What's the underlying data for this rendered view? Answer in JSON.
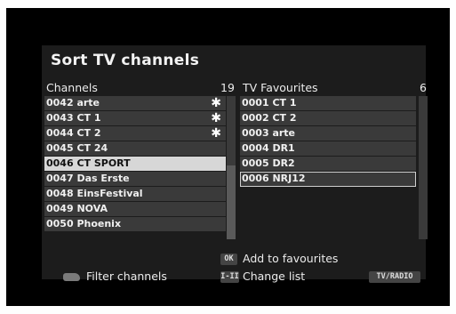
{
  "title": "Sort TV channels",
  "channels": {
    "header": "Channels",
    "count": "19",
    "items": [
      {
        "label": "0042 arte",
        "star": "✱"
      },
      {
        "label": "0043 CT 1",
        "star": "✱"
      },
      {
        "label": "0044 CT 2",
        "star": "✱"
      },
      {
        "label": "0045 CT 24",
        "star": ""
      },
      {
        "label": "0046 CT SPORT",
        "star": ""
      },
      {
        "label": "0047 Das Erste",
        "star": ""
      },
      {
        "label": "0048 EinsFestival",
        "star": ""
      },
      {
        "label": "0049 NOVA",
        "star": ""
      },
      {
        "label": "0050 Phoenix",
        "star": ""
      }
    ]
  },
  "favourites": {
    "header": "TV Favourites",
    "count": "6",
    "items": [
      {
        "label": "0001 CT 1"
      },
      {
        "label": "0002 CT 2"
      },
      {
        "label": "0003 arte"
      },
      {
        "label": "0004 DR1"
      },
      {
        "label": "0005 DR2"
      },
      {
        "label": "0006 NRJ12"
      }
    ]
  },
  "help": {
    "ok_key": "OK",
    "add_label": "Add to favourites",
    "filter_label": "Filter channels",
    "change_key": "I-II",
    "change_label": "Change list",
    "tvradio_key": "TV/RADIO"
  },
  "colors": {
    "panel": "#1c1c1c",
    "row": "#3a3a3a",
    "selected_row": "#d7d7d7"
  }
}
